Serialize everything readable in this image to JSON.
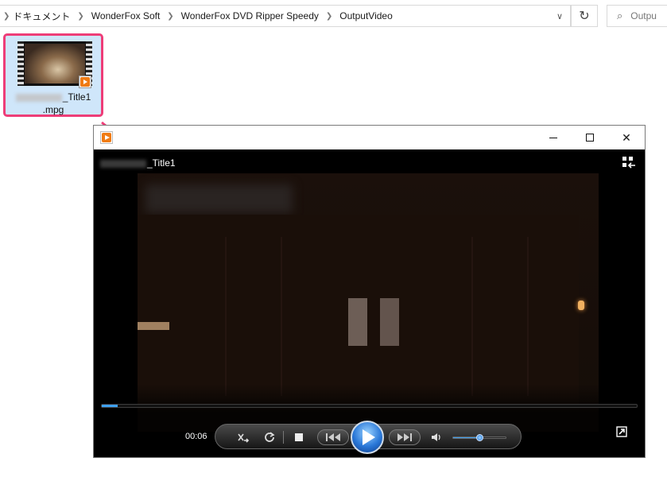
{
  "explorer": {
    "breadcrumbs": [
      "ドキュメント",
      "WonderFox Soft",
      "WonderFox DVD Ripper Speedy",
      "OutputVideo"
    ],
    "search_placeholder": "Outpu",
    "icons": {
      "separator": "chevron-right-icon",
      "dropdown": "chevron-down-icon",
      "refresh": "refresh-icon",
      "search": "search-icon"
    }
  },
  "file": {
    "name_line1": "_Title1",
    "name_line2": ".mpg",
    "selection_color": "#ee3d78"
  },
  "player": {
    "video_title": "_Title1",
    "elapsed": "00:06",
    "progress_fraction": 0.03,
    "volume_fraction": 0.5,
    "accent_color": "#3ea0f0",
    "window_controls": {
      "minimize": "minimize-icon",
      "maximize": "maximize-icon",
      "close": "close-icon",
      "close_glyph": "✕"
    },
    "icons": {
      "shuffle": "shuffle-icon",
      "repeat": "repeat-icon",
      "stop": "stop-icon",
      "previous": "previous-icon",
      "play": "play-icon",
      "next": "next-icon",
      "volume": "volume-icon",
      "switch": "switch-to-library-icon",
      "fullscreen": "fullscreen-icon"
    }
  },
  "annotation": {
    "arrow_color": "#ee3d78"
  }
}
